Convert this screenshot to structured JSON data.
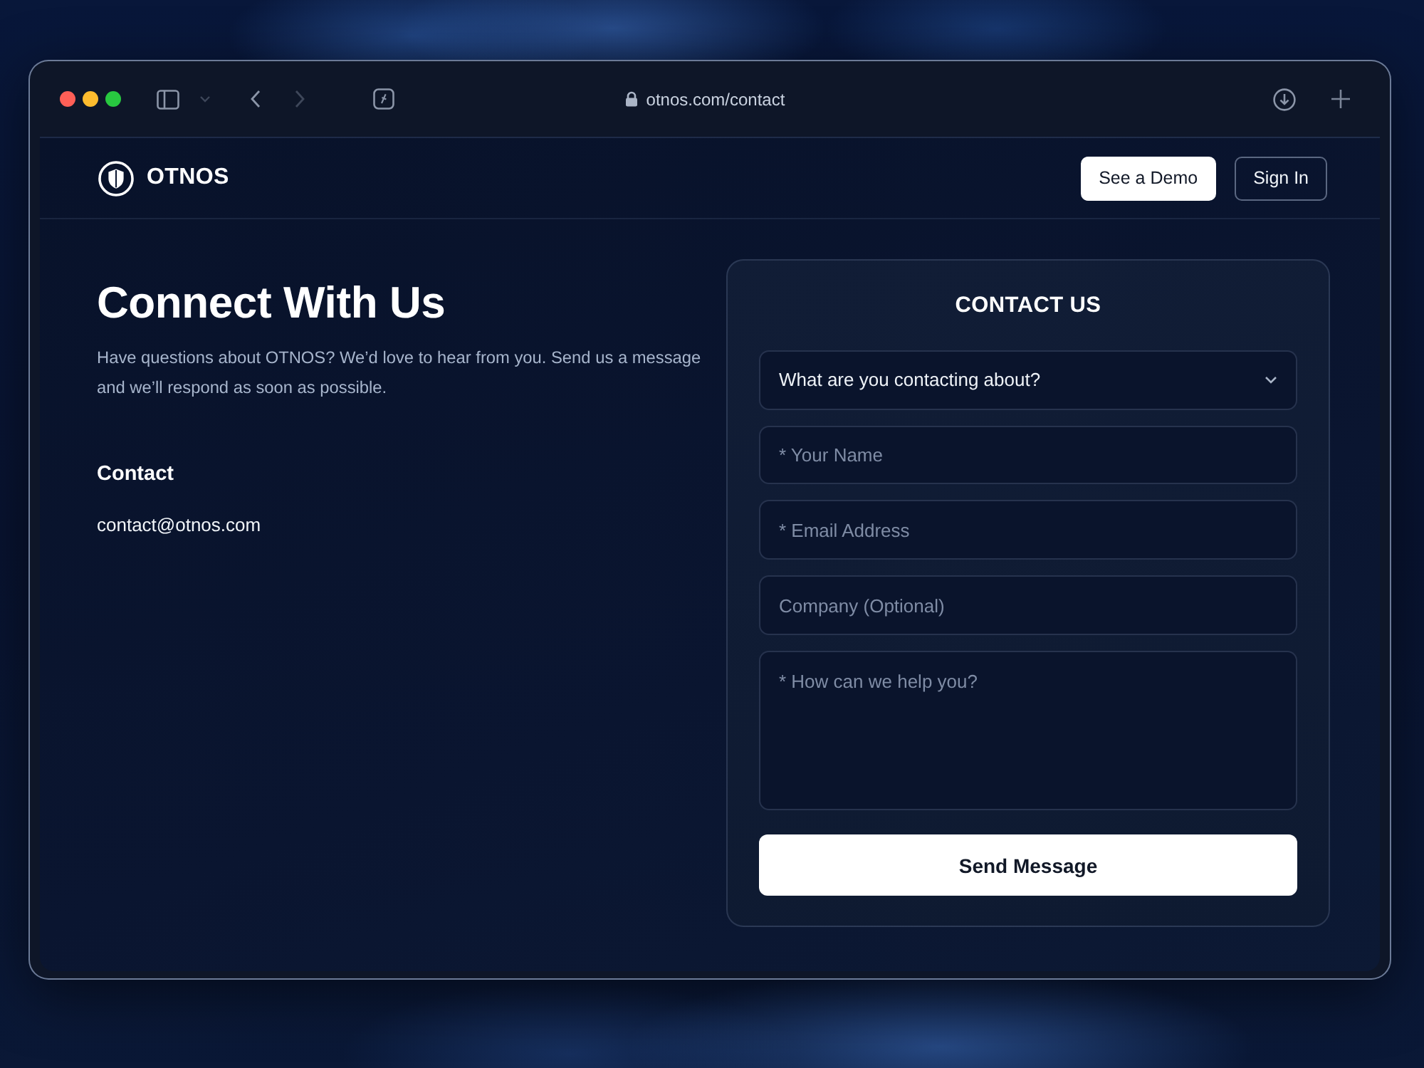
{
  "browser": {
    "url": "otnos.com/contact"
  },
  "header": {
    "logo": "OTNOS",
    "buttons": [
      {
        "label": "See a Demo",
        "kind": "primary"
      },
      {
        "label": "Sign In",
        "kind": "outline"
      }
    ]
  },
  "intro": {
    "title": "Connect With Us",
    "text": "Have questions about OTNOS? We’d love to hear from you. Send us a message and we’ll respond as soon as possible.",
    "contact_heading": "Contact",
    "email": "contact@otnos.com"
  },
  "form": {
    "title": "CONTACT US",
    "fields": [
      {
        "kind": "select",
        "value": "What are you contacting about?"
      },
      {
        "kind": "input",
        "placeholder": "* Your Name"
      },
      {
        "kind": "input",
        "placeholder": "* Email Address"
      },
      {
        "kind": "input",
        "placeholder": "Company (Optional)"
      },
      {
        "kind": "textarea",
        "placeholder": "* How can we help you?"
      }
    ],
    "submit": "Send Message"
  }
}
